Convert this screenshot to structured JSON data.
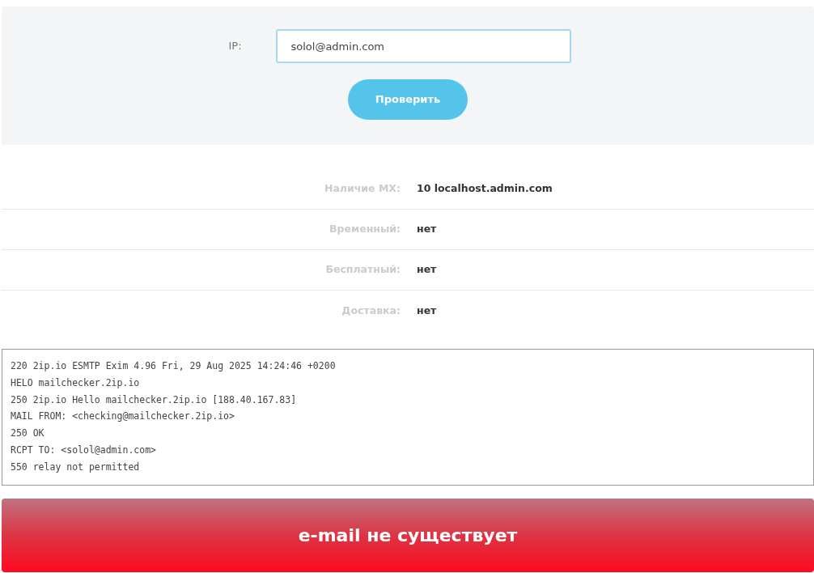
{
  "form": {
    "label": "IP:",
    "value": "solol@admin.com",
    "button": "Проверить"
  },
  "results": [
    {
      "label": "Наличие MX:",
      "value": "10 localhost.admin.com"
    },
    {
      "label": "Временный:",
      "value": "нет"
    },
    {
      "label": "Бесплатный:",
      "value": "нет"
    },
    {
      "label": "Доставка:",
      "value": "нет"
    }
  ],
  "log": [
    "220 2ip.io ESMTP Exim 4.96 Fri, 29 Aug 2025 14:24:46 +0200",
    "HELO mailchecker.2ip.io",
    "250 2ip.io Hello mailchecker.2ip.io [188.40.167.83]",
    "MAIL FROM: <checking@mailchecker.2ip.io>",
    "250 OK",
    "RCPT TO: <solol@admin.com>",
    "550 relay not permitted"
  ],
  "verdict": {
    "kind": "error",
    "text": "e-mail не существует"
  }
}
